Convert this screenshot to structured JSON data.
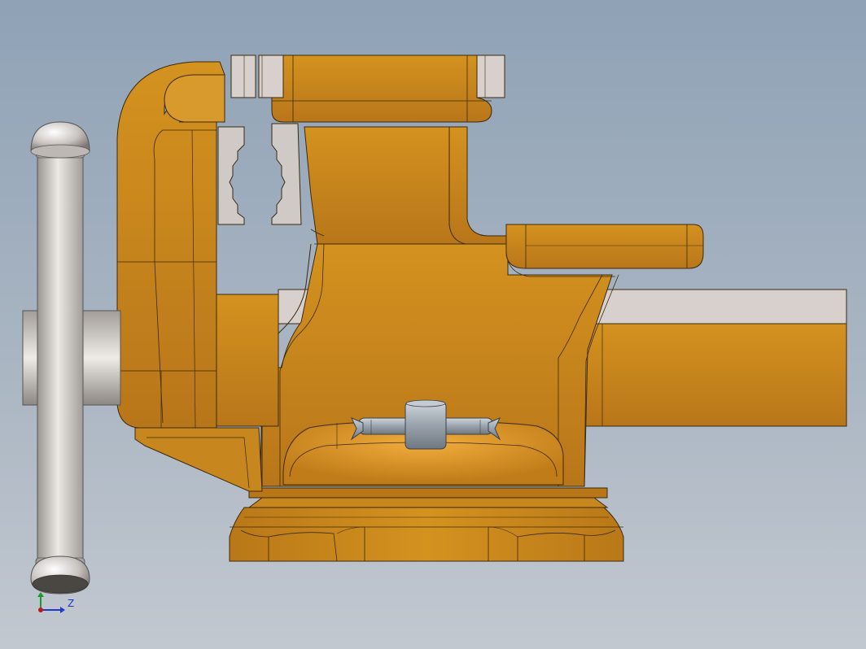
{
  "view": {
    "title": "",
    "model": "bench-vise-assembly",
    "background_top": "#8fa2b6",
    "background_bottom": "#c2c8d0"
  },
  "materials": {
    "body_color": "#c8861e",
    "body_shade": "#a86a12",
    "body_highlight": "#e0a43c",
    "edge_color": "#3a2a10",
    "steel_color": "#cfcac6",
    "steel_shade": "#9a9591",
    "pin_color": "#9ea6ae"
  },
  "triad": {
    "x_label": "",
    "y_label": "",
    "z_label": "Z",
    "y_color": "#1a9a2a",
    "z_color": "#1a3ad0",
    "origin_color": "#c01818"
  },
  "components": [
    {
      "id": "handle",
      "icon": "t-handle-icon"
    },
    {
      "id": "movable-jaw",
      "icon": "jaw-icon"
    },
    {
      "id": "fixed-jaw-body",
      "icon": "vise-body-icon"
    },
    {
      "id": "anvil",
      "icon": "anvil-icon"
    },
    {
      "id": "slide-bar",
      "icon": "bar-icon"
    },
    {
      "id": "lock-pin",
      "icon": "pin-icon"
    },
    {
      "id": "swivel-base",
      "icon": "base-icon"
    }
  ]
}
